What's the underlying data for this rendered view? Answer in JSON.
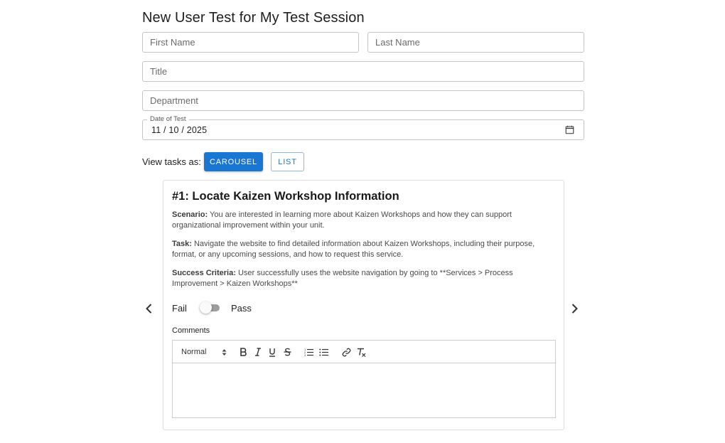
{
  "page": {
    "title": "New User Test for My Test Session"
  },
  "form": {
    "first_name_placeholder": "First Name",
    "last_name_placeholder": "Last Name",
    "title_placeholder": "Title",
    "department_placeholder": "Department",
    "date_label": "Date of Test",
    "date_value": "11 / 10 / 2025"
  },
  "view": {
    "label": "View tasks as:",
    "carousel_label": "CAROUSEL",
    "list_label": "LIST"
  },
  "task": {
    "heading": "#1: Locate Kaizen Workshop Information",
    "scenario_label": "Scenario:",
    "scenario_text": "You are interested in learning more about Kaizen Workshops and how they can support organizational improvement within your unit.",
    "task_label": "Task:",
    "task_text": "Navigate the website to find detailed information about Kaizen Workshops, including their purpose, format, or any upcoming sessions, and how to request this service.",
    "success_label": "Success Criteria:",
    "success_text": "User successfully uses the website navigation by going to **Services > Process Improvement > Kaizen Workshops**",
    "fail_label": "Fail",
    "pass_label": "Pass",
    "toggle_on": false,
    "comments_label": "Comments",
    "editor_format": "Normal"
  },
  "colors": {
    "accent": "#1976d2",
    "border": "#c4c4c4"
  },
  "icons": [
    "calendar-icon",
    "chevron-left-icon",
    "chevron-right-icon",
    "bold-icon",
    "italic-icon",
    "underline-icon",
    "strike-icon",
    "ordered-list-icon",
    "bullet-list-icon",
    "link-icon",
    "clear-format-icon"
  ]
}
